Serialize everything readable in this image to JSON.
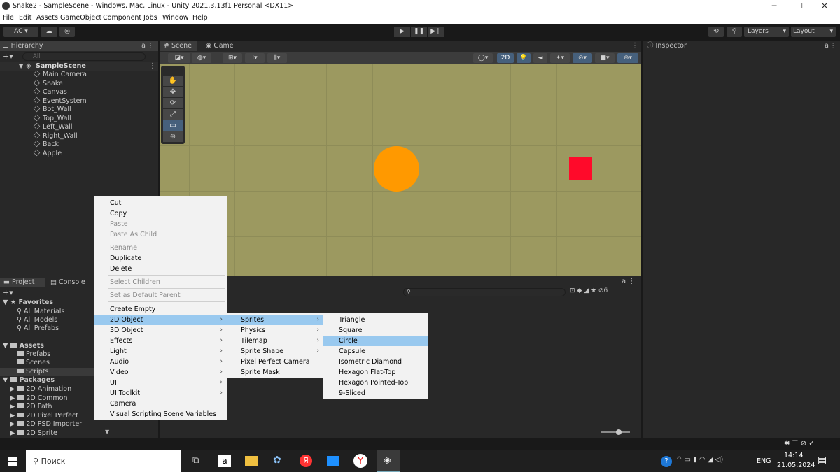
{
  "window": {
    "title": "Snake2 - SampleScene - Windows, Mac, Linux - Unity 2021.3.13f1 Personal <DX11>",
    "minimize": "─",
    "maximize": "☐",
    "close": "✕"
  },
  "menu": [
    "File",
    "Edit",
    "Assets",
    "GameObject",
    "Component",
    "Jobs",
    "Window",
    "Help"
  ],
  "toolbar": {
    "account": "AC ▾",
    "layers": "Layers",
    "layout": "Layout"
  },
  "hierarchy": {
    "title": "Hierarchy",
    "search_placeholder": "All",
    "scene": "SampleScene",
    "objects": [
      "Main Camera",
      "Snake",
      "Canvas",
      "EventSystem",
      "Bot_Wall",
      "Top_Wall",
      "Left_Wall",
      "Right_Wall",
      "Back",
      "Apple"
    ]
  },
  "tabs": {
    "scene": "Scene",
    "game": "Game",
    "inspector": "Inspector",
    "project": "Project",
    "console": "Console",
    "mode2d": "2D"
  },
  "scene_view": {
    "circle_color": "#ff9900",
    "square_color": "#ff0a2a",
    "background": "#9c9960"
  },
  "project": {
    "favorites": "Favorites",
    "favorite_items": [
      "All Materials",
      "All Models",
      "All Prefabs"
    ],
    "assets": "Assets",
    "asset_folders": [
      "Prefabs",
      "Scenes",
      "Scripts"
    ],
    "packages": "Packages",
    "package_folders": [
      "2D Animation",
      "2D Common",
      "2D Path",
      "2D Pixel Perfect",
      "2D PSD Importer",
      "2D Sprite"
    ],
    "count": "6"
  },
  "context_menu": {
    "cut": "Cut",
    "copy": "Copy",
    "paste": "Paste",
    "paste_child": "Paste As Child",
    "rename": "Rename",
    "duplicate": "Duplicate",
    "delete": "Delete",
    "select_children": "Select Children",
    "set_default_parent": "Set as Default Parent",
    "create_empty": "Create Empty",
    "submenus": [
      "2D Object",
      "3D Object",
      "Effects",
      "Light",
      "Audio",
      "Video",
      "UI",
      "UI Toolkit"
    ],
    "camera": "Camera",
    "visual_scripting": "Visual Scripting Scene Variables"
  },
  "submenu_2d": [
    "Sprites",
    "Physics",
    "Tilemap",
    "Sprite Shape",
    "Pixel Perfect Camera",
    "Sprite Mask"
  ],
  "submenu_sprites": [
    "Triangle",
    "Square",
    "Circle",
    "Capsule",
    "Isometric Diamond",
    "Hexagon Flat-Top",
    "Hexagon Pointed-Top",
    "9-Sliced"
  ],
  "taskbar": {
    "search": "Поиск",
    "lang": "ENG",
    "time": "14:14",
    "date": "21.05.2024"
  }
}
